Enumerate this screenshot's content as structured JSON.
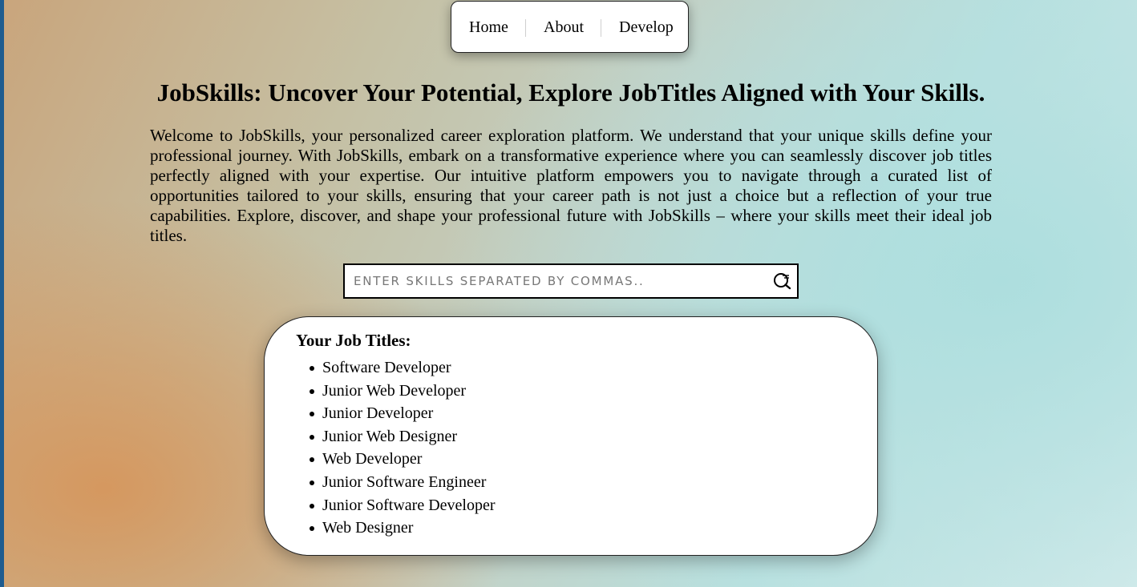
{
  "nav": {
    "items": [
      {
        "label": "Home"
      },
      {
        "label": "About"
      },
      {
        "label": "Develop"
      }
    ]
  },
  "hero": {
    "title": "JobSkills: Uncover Your Potential, Explore JobTitles Aligned with Your Skills.",
    "description": "Welcome to JobSkills, your personalized career exploration platform. We understand that your unique skills define your professional journey. With JobSkills, embark on a transformative experience where you can seamlessly discover job titles perfectly aligned with your expertise. Our intuitive platform empowers you to navigate through a curated list of opportunities tailored to your skills, ensuring that your career path is not just a choice but a reflection of your true capabilities. Explore, discover, and shape your professional future with JobSkills – where your skills meet their ideal job titles."
  },
  "search": {
    "placeholder": "ENTER SKILLS SEPARATED BY COMMAS..",
    "value": "",
    "icon": "search-icon"
  },
  "results": {
    "title": "Your Job Titles:",
    "items": [
      "Software Developer",
      "Junior Web Developer",
      "Junior Developer",
      "Junior Web Designer",
      "Web Developer",
      "Junior Software Engineer",
      "Junior Software Developer",
      "Web Designer"
    ]
  },
  "colors": {
    "left_edge": "#1f5c8f",
    "warm_gradient": "#d6965c",
    "cool_gradient": "#b8e0df"
  }
}
